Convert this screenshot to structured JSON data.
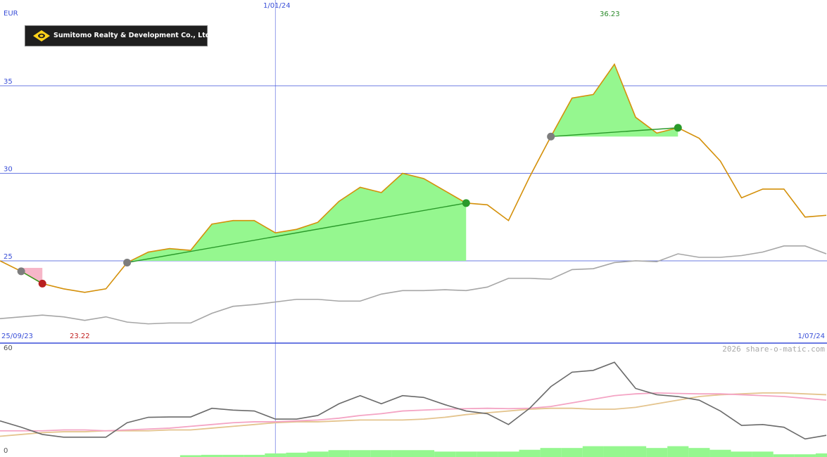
{
  "company": "Sumitomo Realty & Development Co., Ltd.",
  "credit": "2026 share-o-matic.com",
  "chart_data": [
    {
      "type": "line",
      "currency": "EUR",
      "start_date_label": "25/09/23",
      "mid_date_label": "1/01/24",
      "end_date_label": "1/07/24",
      "y_ticks": [
        25,
        30,
        35
      ],
      "ylim": [
        20.3,
        39.9
      ],
      "max_label": "36.23",
      "min_label": "23.22",
      "x_count": 40,
      "x_marker_index": 13,
      "colors": {
        "price": "#d4900a",
        "comparison": "#a6a6a6",
        "gain": "#95f78f",
        "loss": "#f6b6c8",
        "trend": "#2a9a2a",
        "grid": "#3a4fd8",
        "max_text": "#2a8a2a",
        "min_text": "#c02020"
      },
      "series": [
        {
          "values": [
            25.0,
            24.4,
            23.7,
            23.4,
            23.2,
            23.4,
            24.9,
            25.5,
            25.7,
            25.6,
            27.1,
            27.3,
            27.3,
            26.6,
            26.8,
            27.2,
            28.4,
            29.2,
            28.9,
            30.0,
            29.7,
            29.0,
            28.3,
            28.2,
            27.3,
            29.8,
            32.1,
            34.3,
            34.5,
            36.23,
            33.2,
            32.3,
            32.6,
            32.0,
            30.7,
            28.6,
            29.1,
            29.1,
            27.5,
            27.6
          ]
        },
        {
          "values": [
            21.7,
            21.8,
            21.9,
            21.8,
            21.6,
            21.8,
            21.5,
            21.4,
            21.45,
            21.45,
            22.0,
            22.4,
            22.5,
            22.65,
            22.8,
            22.8,
            22.7,
            22.7,
            23.1,
            23.3,
            23.3,
            23.35,
            23.3,
            23.5,
            24.0,
            24.0,
            23.95,
            24.5,
            24.55,
            24.9,
            25.0,
            24.95,
            25.4,
            25.2,
            25.2,
            25.3,
            25.5,
            25.85,
            25.85,
            25.4
          ]
        }
      ],
      "gain_regions": [
        {
          "from": 6,
          "to": 22,
          "base": 25.0
        },
        {
          "from": 26,
          "to": 32,
          "base": 32.1
        }
      ],
      "loss_regions": [
        {
          "from": 1,
          "to": 2,
          "base": 24.6
        }
      ],
      "trend_lines": [
        {
          "from": 6,
          "to": 22,
          "start_marker": "grey",
          "end_marker": "green"
        },
        {
          "from": 26,
          "to": 32,
          "start_marker": "grey",
          "end_marker": "green"
        },
        {
          "from": 1,
          "to": 2,
          "start_marker": "grey",
          "end_marker": "red"
        }
      ]
    },
    {
      "type": "line",
      "y_top_label": "60",
      "y_bottom_label": "0",
      "ylim": [
        0,
        60
      ],
      "colors": {
        "oscillator": "#6a6a6a",
        "signal_pink": "#f4a4c4",
        "signal_tan": "#e4c48e",
        "volume": "#95f78f"
      },
      "series": [
        {
          "values": [
            20.0,
            16.5,
            12.5,
            11.0,
            11.0,
            11.0,
            19.0,
            22.0,
            22.2,
            22.2,
            27.0,
            26.0,
            25.5,
            21.0,
            21.0,
            23.0,
            29.5,
            34.0,
            29.5,
            34.0,
            33.0,
            29.0,
            25.5,
            24.0,
            18.0,
            27.0,
            39.0,
            47.0,
            48.0,
            52.5,
            38.0,
            34.5,
            33.5,
            31.5,
            25.5,
            17.5,
            18.0,
            16.5,
            10.0,
            12.0
          ]
        },
        {
          "values": [
            14.5,
            14.5,
            14.5,
            15.0,
            15.0,
            14.5,
            15.0,
            15.5,
            16.0,
            17.0,
            18.0,
            19.0,
            19.5,
            19.5,
            20.0,
            20.5,
            21.5,
            23.0,
            24.0,
            25.5,
            26.0,
            26.5,
            26.8,
            27.0,
            26.8,
            27.0,
            28.0,
            30.0,
            32.0,
            34.0,
            35.0,
            35.5,
            35.2,
            35.0,
            35.0,
            34.5,
            34.0,
            33.5,
            32.5,
            31.5
          ]
        },
        {
          "values": [
            11.5,
            12.5,
            13.5,
            14.0,
            14.0,
            14.5,
            14.5,
            14.5,
            15.0,
            15.0,
            16.0,
            17.0,
            18.0,
            19.0,
            19.5,
            19.5,
            20.0,
            20.5,
            20.5,
            20.5,
            21.0,
            22.0,
            23.5,
            24.5,
            25.5,
            26.5,
            27.0,
            27.0,
            26.5,
            26.5,
            27.5,
            29.5,
            31.5,
            33.5,
            34.5,
            35.0,
            35.5,
            35.5,
            35.0,
            34.5
          ]
        }
      ],
      "volume": [
        0,
        0,
        0,
        0,
        0,
        0,
        0,
        0,
        0,
        1.0,
        1.2,
        1.2,
        1.2,
        2.0,
        2.4,
        3.0,
        3.8,
        3.8,
        3.8,
        3.8,
        3.8,
        3.0,
        3.0,
        3.0,
        3.0,
        4.0,
        5.0,
        5.0,
        6.0,
        6.0,
        6.0,
        5.0,
        6.0,
        5.0,
        4.0,
        3.0,
        3.0,
        1.5,
        1.5,
        2.0
      ]
    }
  ]
}
